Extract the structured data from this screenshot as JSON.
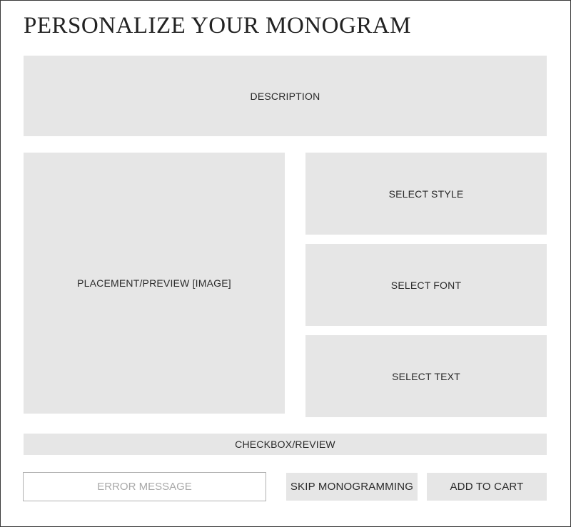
{
  "page": {
    "title": "PERSONALIZE YOUR MONOGRAM"
  },
  "sections": {
    "description": "DESCRIPTION",
    "preview": "PLACEMENT/PREVIEW [IMAGE]",
    "select_style": "SELECT STYLE",
    "select_font": "SELECT FONT",
    "select_text": "SELECT TEXT",
    "checkbox_review": "CHECKBOX/REVIEW"
  },
  "footer": {
    "error_message": "ERROR MESSAGE",
    "skip_button": "SKIP MONOGRAMMING",
    "add_to_cart_button": "ADD TO CART"
  },
  "colors": {
    "placeholder_fill": "#e6e6e6",
    "border": "#3a3a3a",
    "error_text": "#a8a8a8"
  }
}
